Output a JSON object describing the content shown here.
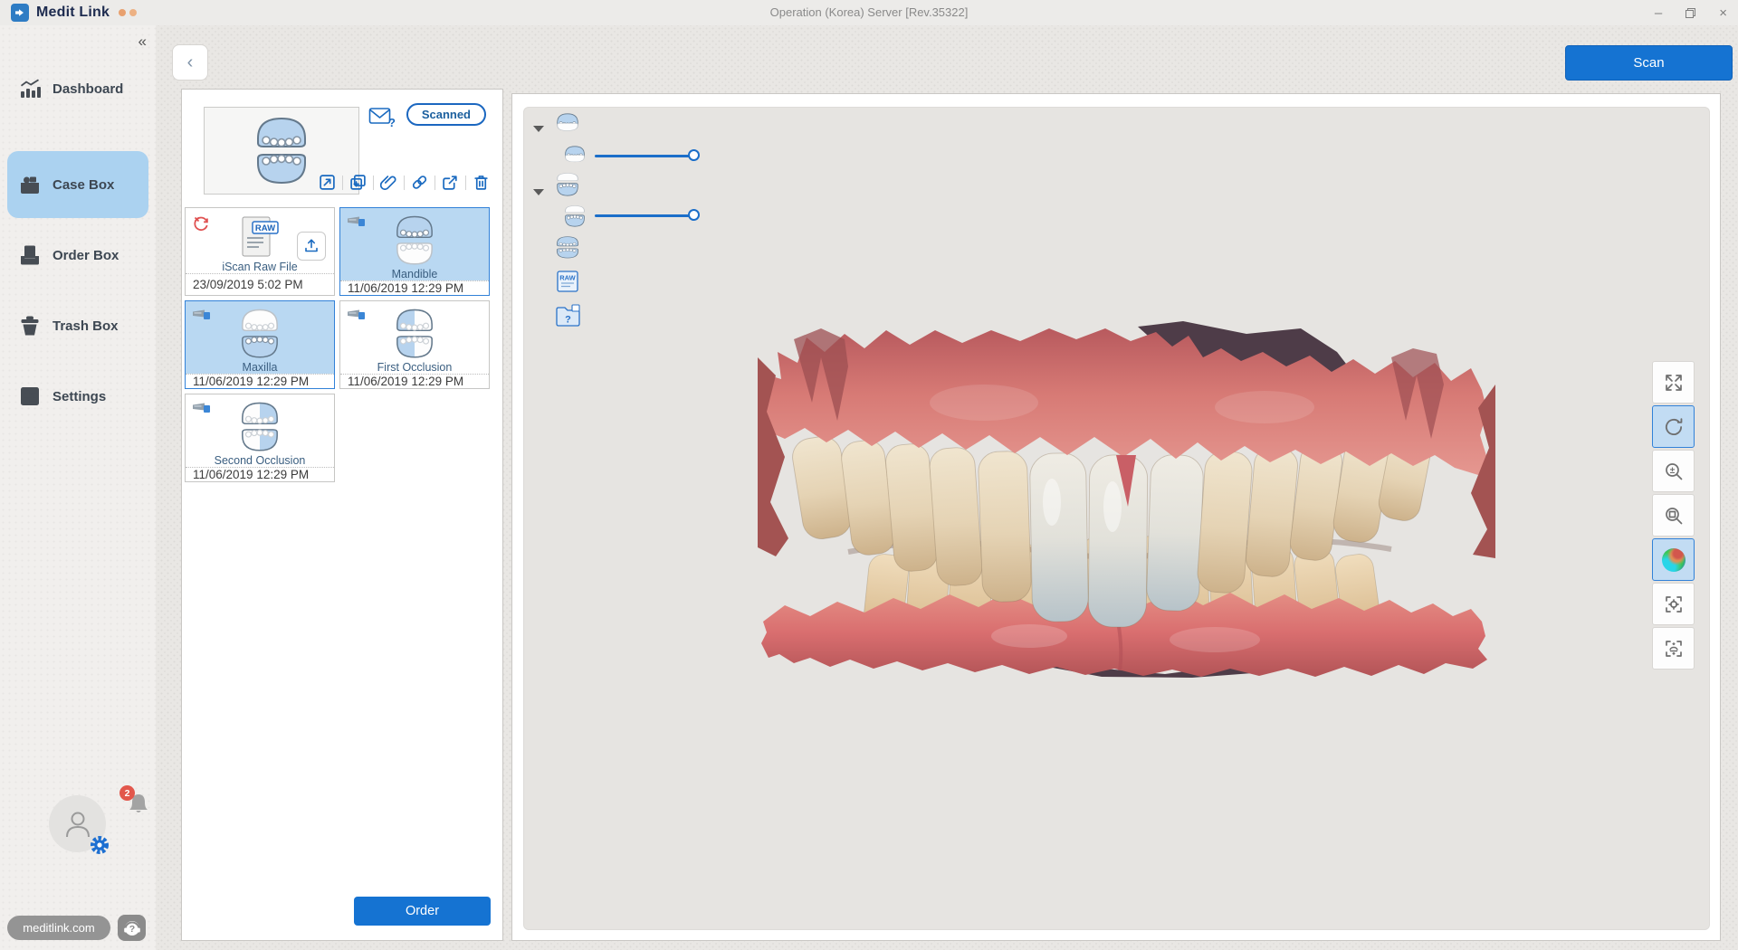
{
  "window": {
    "app_name": "Medit Link",
    "title": "Operation (Korea) Server [Rev.35322]"
  },
  "glyphs": {
    "question": "?",
    "collapse": "«",
    "back": "‹",
    "minimize": "–",
    "close": "×"
  },
  "labels": {
    "raw": "RAW"
  },
  "sidebar": {
    "items": [
      {
        "label": "Dashboard",
        "active": false
      },
      {
        "label": "Case Box",
        "active": true
      },
      {
        "label": "Order Box",
        "active": false
      },
      {
        "label": "Trash Box",
        "active": false
      },
      {
        "label": "Settings",
        "active": false
      }
    ],
    "notification_count": "2",
    "website_label": "meditlink.com"
  },
  "topbar": {
    "scan_label": "Scan"
  },
  "case_panel": {
    "status_badge": "Scanned",
    "order_label": "Order",
    "files": [
      {
        "name": "iScan Raw File",
        "date": "23/09/2019 5:02 PM",
        "selected": false,
        "type": "raw-file"
      },
      {
        "name": "Mandible",
        "date": "11/06/2019 12:29 PM",
        "selected": true,
        "type": "mandible-scan"
      },
      {
        "name": "Maxilla",
        "date": "11/06/2019 12:29 PM",
        "selected": true,
        "type": "maxilla-scan"
      },
      {
        "name": "First Occlusion",
        "date": "11/06/2019 12:29 PM",
        "selected": false,
        "type": "occlusion-scan"
      },
      {
        "name": "Second Occlusion",
        "date": "11/06/2019 12:29 PM",
        "selected": false,
        "type": "occlusion-scan"
      }
    ]
  },
  "viewer": {
    "sliders": [
      {
        "value": 100
      },
      {
        "value": 100
      }
    ],
    "tools": [
      {
        "name": "fullscreen",
        "selected": false
      },
      {
        "name": "rotate",
        "selected": true
      },
      {
        "name": "zoom",
        "selected": false
      },
      {
        "name": "zoom-area",
        "selected": false
      },
      {
        "name": "texture-color",
        "selected": true
      },
      {
        "name": "focus-center",
        "selected": false
      },
      {
        "name": "fit-model",
        "selected": false
      }
    ]
  },
  "colors": {
    "accent_blue": "#1573d2",
    "icon_blue": "#1a6ac0",
    "selection_fill": "#b9d8f2",
    "selection_border": "#3181d8",
    "error_red": "#e05252",
    "notification_red": "#e2574c"
  }
}
